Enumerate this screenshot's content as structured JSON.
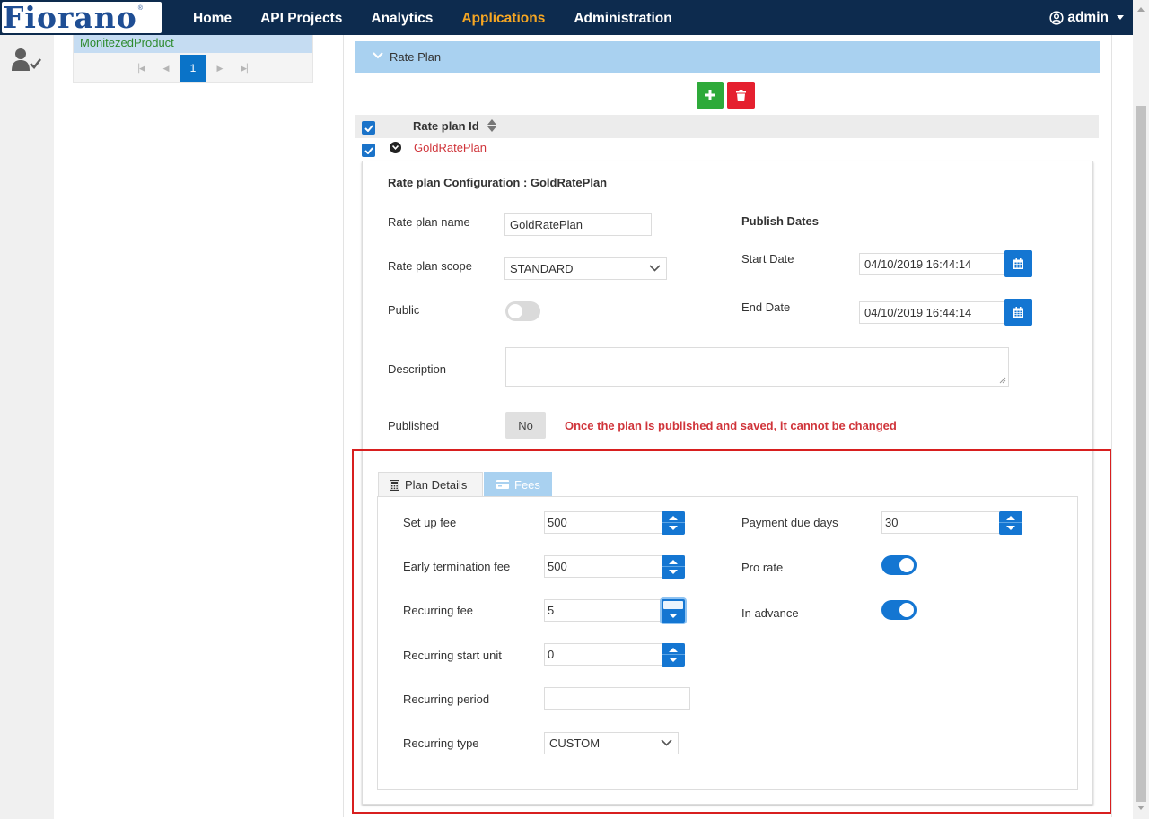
{
  "app": {
    "logo_text": "Fiorano",
    "logo_mark": "®"
  },
  "nav": {
    "items": [
      {
        "label": "Home",
        "active": false
      },
      {
        "label": "API Projects",
        "active": false
      },
      {
        "label": "Analytics",
        "active": false
      },
      {
        "label": "Applications",
        "active": true
      },
      {
        "label": "Administration",
        "active": false
      }
    ],
    "user": "admin"
  },
  "sidebar": {
    "list_item": "MonitezedProduct",
    "pager": {
      "current_page": "1"
    }
  },
  "rate_plan": {
    "section_title": "Rate Plan",
    "column_header": "Rate plan Id",
    "row_value": "GoldRatePlan",
    "config_title": "Rate plan Configuration : GoldRatePlan",
    "fields": {
      "name_label": "Rate plan name",
      "name_value": "GoldRatePlan",
      "scope_label": "Rate plan scope",
      "scope_value": "STANDARD",
      "public_label": "Public",
      "public_on": false,
      "description_label": "Description",
      "description_value": "",
      "published_label": "Published",
      "published_button": "No",
      "published_warning": "Once the plan is published and saved, it cannot be changed"
    },
    "publish_dates": {
      "title": "Publish Dates",
      "start_label": "Start Date",
      "start_value": "04/10/2019 16:44:14",
      "end_label": "End Date",
      "end_value": "04/10/2019 16:44:14"
    },
    "tabs": [
      {
        "label": "Plan Details",
        "active": true
      },
      {
        "label": "Fees",
        "active": false
      }
    ],
    "plan_details": {
      "setup_fee_label": "Set up fee",
      "setup_fee": "500",
      "early_term_label": "Early termination fee",
      "early_term": "500",
      "recurring_fee_label": "Recurring fee",
      "recurring_fee": "5",
      "recurring_start_label": "Recurring start unit",
      "recurring_start": "0",
      "recurring_period_label": "Recurring period",
      "recurring_period": "",
      "recurring_type_label": "Recurring type",
      "recurring_type": "CUSTOM",
      "payment_due_label": "Payment due days",
      "payment_due": "30",
      "pro_rate_label": "Pro rate",
      "pro_rate_on": true,
      "in_advance_label": "In advance",
      "in_advance_on": true
    }
  },
  "colors": {
    "navbar": "#0d2b4e",
    "nav_active": "#f5a623",
    "primary": "#1476d2",
    "section_header": "#a9d1f0",
    "add_button": "#2eaa3a",
    "delete_button": "#e5202f",
    "warning_text": "#d0343a",
    "highlight_border": "#d81f1f"
  }
}
